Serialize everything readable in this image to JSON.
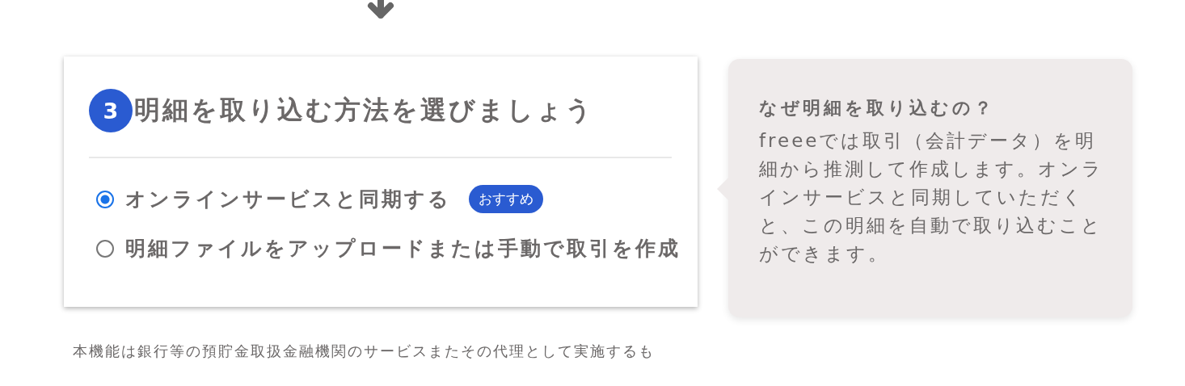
{
  "step": {
    "number": "3",
    "title": "明細を取り込む方法を選びましょう"
  },
  "options": [
    {
      "label": "オンラインサービスと同期する",
      "selected": true,
      "badge": "おすすめ"
    },
    {
      "label": "明細ファイルをアップロードまたは手動で取引を作成",
      "selected": false
    }
  ],
  "tip": {
    "title": "なぜ明細を取り込むの？",
    "body": "freeeでは取引（会計データ）を明細から推測して作成します。オンラインサービスと同期していただくと、この明細を自動で取り込むことができます。"
  },
  "disclaimer": "本機能は銀行等の預貯金取扱金融機関のサービスまたその代理として実施するも"
}
